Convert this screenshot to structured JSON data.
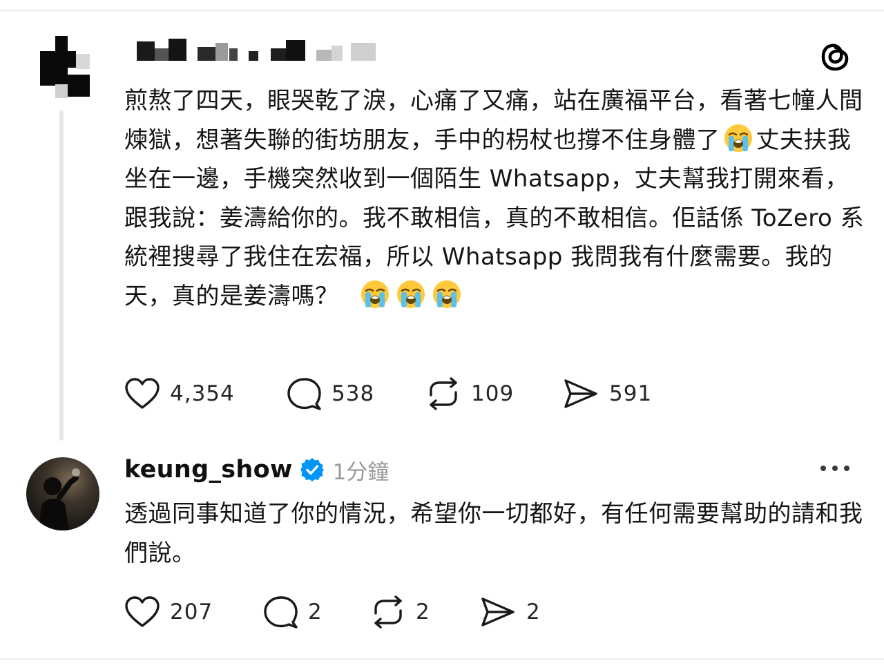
{
  "post": {
    "author_censored": true,
    "text_part1": "煎熬了四天，眼哭乾了淚，心痛了又痛，站在廣福平台，看著七幢人間煉獄，想著失聯的街坊朋友，手中的枴杖也撐不住身體了",
    "text_part2": "丈夫扶我坐在一邊，手機突然收到一個陌生 Whatsapp，丈夫幫我打開來看，跟我說：姜濤給你的。我不敢相信，真的不敢相信。佢話係 ToZero 系統裡搜尋了我住在宏福，所以 Whatsapp 我問我有什麼需要。我的天，真的是姜濤嗎？",
    "emoji_name": "loudly-crying-face",
    "stats": {
      "likes": "4,354",
      "comments": "538",
      "reposts": "109",
      "shares": "591"
    }
  },
  "reply": {
    "username": "keung_show",
    "verified": true,
    "timestamp": "1分鐘",
    "text": "透過同事知道了你的情況，希望你一切都好，有任何需要幫助的請和我們說。",
    "stats": {
      "likes": "207",
      "comments": "2",
      "reposts": "2",
      "shares": "2"
    }
  },
  "icons": {
    "app_logo": "threads-logo-icon",
    "like": "heart-icon",
    "comment": "comment-bubble-icon",
    "repost": "repost-icon",
    "share": "send-icon",
    "more": "more-options-icon",
    "verified": "verified-badge-icon"
  },
  "colors": {
    "verified_blue": "#0095f6",
    "muted_text": "#9a9a9a",
    "text": "#151515"
  }
}
